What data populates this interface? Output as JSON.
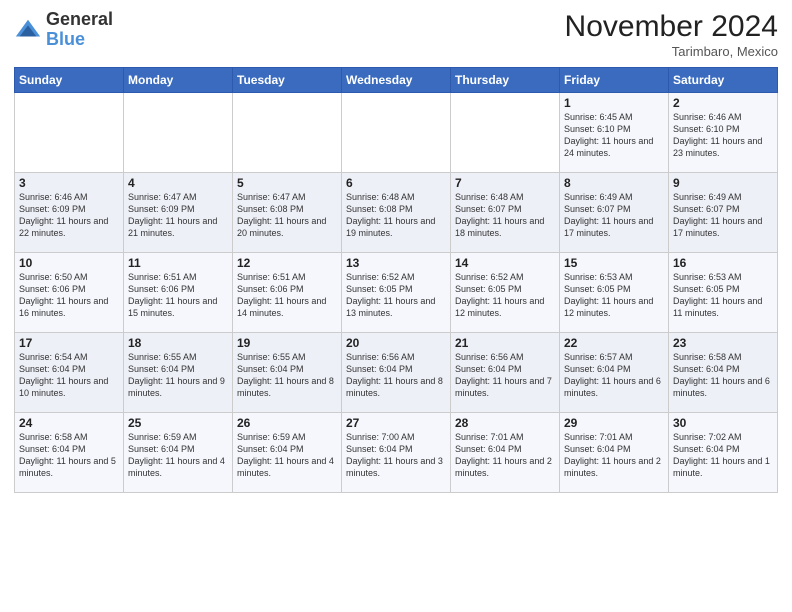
{
  "header": {
    "logo_general": "General",
    "logo_blue": "Blue",
    "month_title": "November 2024",
    "location": "Tarimbaro, Mexico"
  },
  "days_of_week": [
    "Sunday",
    "Monday",
    "Tuesday",
    "Wednesday",
    "Thursday",
    "Friday",
    "Saturday"
  ],
  "weeks": [
    [
      {
        "day": "",
        "info": ""
      },
      {
        "day": "",
        "info": ""
      },
      {
        "day": "",
        "info": ""
      },
      {
        "day": "",
        "info": ""
      },
      {
        "day": "",
        "info": ""
      },
      {
        "day": "1",
        "info": "Sunrise: 6:45 AM\nSunset: 6:10 PM\nDaylight: 11 hours and 24 minutes."
      },
      {
        "day": "2",
        "info": "Sunrise: 6:46 AM\nSunset: 6:10 PM\nDaylight: 11 hours and 23 minutes."
      }
    ],
    [
      {
        "day": "3",
        "info": "Sunrise: 6:46 AM\nSunset: 6:09 PM\nDaylight: 11 hours and 22 minutes."
      },
      {
        "day": "4",
        "info": "Sunrise: 6:47 AM\nSunset: 6:09 PM\nDaylight: 11 hours and 21 minutes."
      },
      {
        "day": "5",
        "info": "Sunrise: 6:47 AM\nSunset: 6:08 PM\nDaylight: 11 hours and 20 minutes."
      },
      {
        "day": "6",
        "info": "Sunrise: 6:48 AM\nSunset: 6:08 PM\nDaylight: 11 hours and 19 minutes."
      },
      {
        "day": "7",
        "info": "Sunrise: 6:48 AM\nSunset: 6:07 PM\nDaylight: 11 hours and 18 minutes."
      },
      {
        "day": "8",
        "info": "Sunrise: 6:49 AM\nSunset: 6:07 PM\nDaylight: 11 hours and 17 minutes."
      },
      {
        "day": "9",
        "info": "Sunrise: 6:49 AM\nSunset: 6:07 PM\nDaylight: 11 hours and 17 minutes."
      }
    ],
    [
      {
        "day": "10",
        "info": "Sunrise: 6:50 AM\nSunset: 6:06 PM\nDaylight: 11 hours and 16 minutes."
      },
      {
        "day": "11",
        "info": "Sunrise: 6:51 AM\nSunset: 6:06 PM\nDaylight: 11 hours and 15 minutes."
      },
      {
        "day": "12",
        "info": "Sunrise: 6:51 AM\nSunset: 6:06 PM\nDaylight: 11 hours and 14 minutes."
      },
      {
        "day": "13",
        "info": "Sunrise: 6:52 AM\nSunset: 6:05 PM\nDaylight: 11 hours and 13 minutes."
      },
      {
        "day": "14",
        "info": "Sunrise: 6:52 AM\nSunset: 6:05 PM\nDaylight: 11 hours and 12 minutes."
      },
      {
        "day": "15",
        "info": "Sunrise: 6:53 AM\nSunset: 6:05 PM\nDaylight: 11 hours and 12 minutes."
      },
      {
        "day": "16",
        "info": "Sunrise: 6:53 AM\nSunset: 6:05 PM\nDaylight: 11 hours and 11 minutes."
      }
    ],
    [
      {
        "day": "17",
        "info": "Sunrise: 6:54 AM\nSunset: 6:04 PM\nDaylight: 11 hours and 10 minutes."
      },
      {
        "day": "18",
        "info": "Sunrise: 6:55 AM\nSunset: 6:04 PM\nDaylight: 11 hours and 9 minutes."
      },
      {
        "day": "19",
        "info": "Sunrise: 6:55 AM\nSunset: 6:04 PM\nDaylight: 11 hours and 8 minutes."
      },
      {
        "day": "20",
        "info": "Sunrise: 6:56 AM\nSunset: 6:04 PM\nDaylight: 11 hours and 8 minutes."
      },
      {
        "day": "21",
        "info": "Sunrise: 6:56 AM\nSunset: 6:04 PM\nDaylight: 11 hours and 7 minutes."
      },
      {
        "day": "22",
        "info": "Sunrise: 6:57 AM\nSunset: 6:04 PM\nDaylight: 11 hours and 6 minutes."
      },
      {
        "day": "23",
        "info": "Sunrise: 6:58 AM\nSunset: 6:04 PM\nDaylight: 11 hours and 6 minutes."
      }
    ],
    [
      {
        "day": "24",
        "info": "Sunrise: 6:58 AM\nSunset: 6:04 PM\nDaylight: 11 hours and 5 minutes."
      },
      {
        "day": "25",
        "info": "Sunrise: 6:59 AM\nSunset: 6:04 PM\nDaylight: 11 hours and 4 minutes."
      },
      {
        "day": "26",
        "info": "Sunrise: 6:59 AM\nSunset: 6:04 PM\nDaylight: 11 hours and 4 minutes."
      },
      {
        "day": "27",
        "info": "Sunrise: 7:00 AM\nSunset: 6:04 PM\nDaylight: 11 hours and 3 minutes."
      },
      {
        "day": "28",
        "info": "Sunrise: 7:01 AM\nSunset: 6:04 PM\nDaylight: 11 hours and 2 minutes."
      },
      {
        "day": "29",
        "info": "Sunrise: 7:01 AM\nSunset: 6:04 PM\nDaylight: 11 hours and 2 minutes."
      },
      {
        "day": "30",
        "info": "Sunrise: 7:02 AM\nSunset: 6:04 PM\nDaylight: 11 hours and 1 minute."
      }
    ]
  ]
}
